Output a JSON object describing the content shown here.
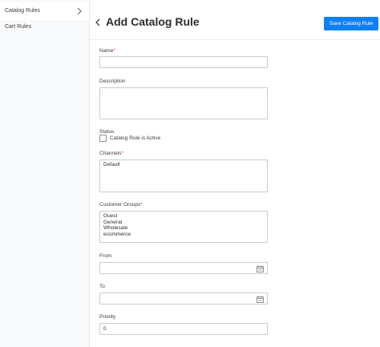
{
  "sidebar": {
    "items": [
      {
        "label": "Catalog Rules"
      },
      {
        "label": "Cart Rules"
      }
    ]
  },
  "header": {
    "title": "Add Catalog Rule",
    "save_label": "Save Catalog Rule"
  },
  "form": {
    "name": {
      "label": "Name",
      "required": "*",
      "value": ""
    },
    "description": {
      "label": "Description",
      "value": ""
    },
    "status": {
      "label": "Status",
      "checkbox_label": "Catalog Rule is Active",
      "checked": false
    },
    "channels": {
      "label": "Channels",
      "required": "*",
      "options": [
        "Default"
      ]
    },
    "customer_groups": {
      "label": "Customer Groups",
      "required": "*",
      "options": [
        "Guest",
        "General",
        "Wholesale",
        "ecommerce"
      ]
    },
    "from": {
      "label": "From",
      "value": "",
      "icon": "calendar-icon"
    },
    "to": {
      "label": "To",
      "value": "",
      "icon": "calendar-icon"
    },
    "priority": {
      "label": "Priority",
      "value": "0"
    }
  },
  "colors": {
    "accent": "#0f7ff6",
    "required": "#e53935",
    "sidebar_bg": "#f8f9fb"
  }
}
